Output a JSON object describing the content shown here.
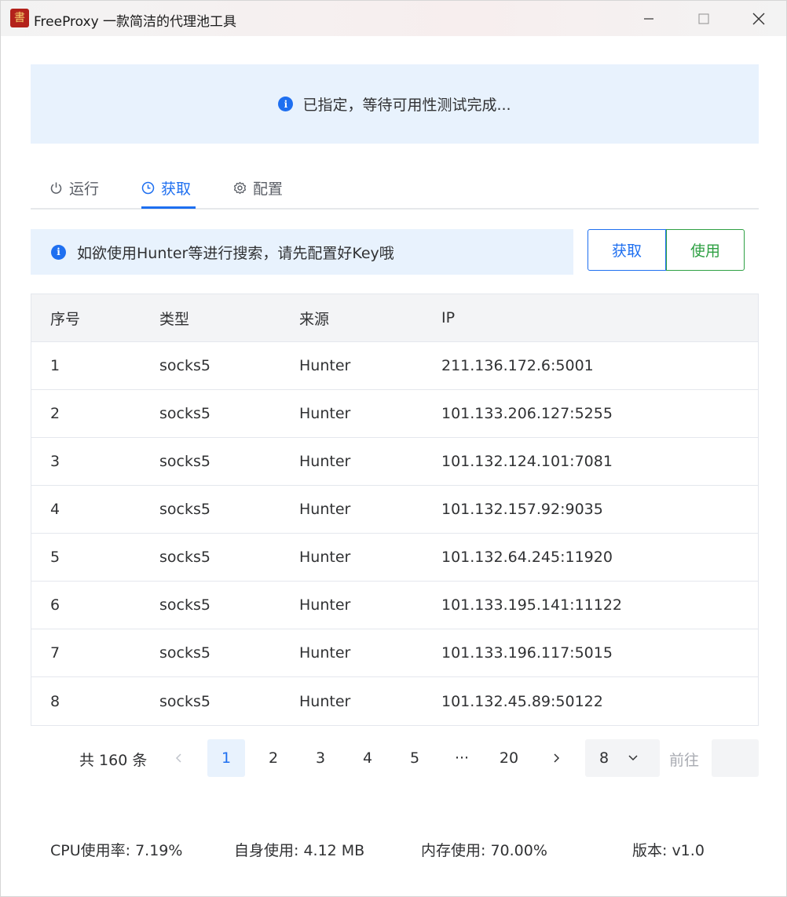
{
  "window": {
    "title": "FreeProxy 一款简洁的代理池工具",
    "logo_icon": "app-logo-icon"
  },
  "alert_top": {
    "text": "已指定，等待可用性测试完成..."
  },
  "tabs": [
    {
      "label": "运行",
      "icon": "power-icon"
    },
    {
      "label": "获取",
      "icon": "clock-icon",
      "active": true
    },
    {
      "label": "配置",
      "icon": "gear-icon"
    }
  ],
  "hint": {
    "text": "如欲使用Hunter等进行搜索，请先配置好Key哦"
  },
  "buttons": {
    "fetch": "获取",
    "use": "使用"
  },
  "table": {
    "headers": [
      "序号",
      "类型",
      "来源",
      "IP"
    ],
    "rows": [
      [
        "1",
        "socks5",
        "Hunter",
        "211.136.172.6:5001"
      ],
      [
        "2",
        "socks5",
        "Hunter",
        "101.133.206.127:5255"
      ],
      [
        "3",
        "socks5",
        "Hunter",
        "101.132.124.101:7081"
      ],
      [
        "4",
        "socks5",
        "Hunter",
        "101.132.157.92:9035"
      ],
      [
        "5",
        "socks5",
        "Hunter",
        "101.132.64.245:11920"
      ],
      [
        "6",
        "socks5",
        "Hunter",
        "101.133.195.141:11122"
      ],
      [
        "7",
        "socks5",
        "Hunter",
        "101.133.196.117:5015"
      ],
      [
        "8",
        "socks5",
        "Hunter",
        "101.132.45.89:50122"
      ]
    ]
  },
  "pagination": {
    "total": "共 160 条",
    "pages": [
      "1",
      "2",
      "3",
      "4",
      "5",
      "···",
      "20"
    ],
    "current": "1",
    "page_size": "8",
    "goto_label": "前往",
    "goto_value": ""
  },
  "status": {
    "cpu": "CPU使用率: 7.19%",
    "self": "自身使用: 4.12 MB",
    "mem": "内存使用: 70.00%",
    "version": "版本: v1.0"
  },
  "colors": {
    "accent": "#1e6ff0",
    "success": "#2ea043",
    "alert_bg": "#e8f2fd"
  }
}
